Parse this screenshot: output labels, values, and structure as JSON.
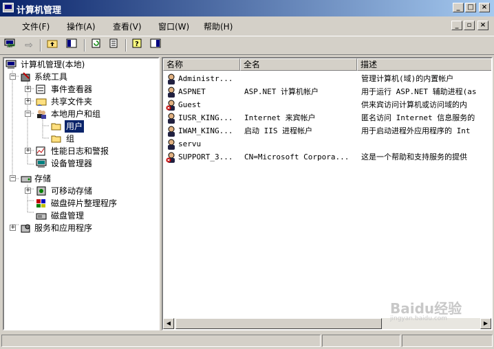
{
  "window": {
    "title": "计算机管理"
  },
  "menu": {
    "file": "文件(F)",
    "action": "操作(A)",
    "view": "查看(V)",
    "window": "窗口(W)",
    "help": "帮助(H)"
  },
  "tree": {
    "root": "计算机管理(本地)",
    "system_tools": "系统工具",
    "event_viewer": "事件查看器",
    "shared_folders": "共享文件夹",
    "local_users_groups": "本地用户和组",
    "users": "用户",
    "groups": "组",
    "perf_logs": "性能日志和警报",
    "device_manager": "设备管理器",
    "storage": "存储",
    "removable_storage": "可移动存储",
    "defrag": "磁盘碎片整理程序",
    "disk_mgmt": "磁盘管理",
    "services_apps": "服务和应用程序"
  },
  "list": {
    "columns": {
      "name": "名称",
      "fullname": "全名",
      "description": "描述"
    },
    "rows": [
      {
        "name": "Administr...",
        "fullname": "",
        "description": "管理计算机(域)的内置帐户",
        "icon": "user-icon"
      },
      {
        "name": "ASPNET",
        "fullname": "ASP.NET 计算机帐户",
        "description": "用于运行 ASP.NET 辅助进程(as",
        "icon": "user-icon"
      },
      {
        "name": "Guest",
        "fullname": "",
        "description": "供来宾访问计算机或访问域的内",
        "icon": "user-disabled-icon"
      },
      {
        "name": "IUSR_KING...",
        "fullname": "Internet 来宾帐户",
        "description": "匿名访问 Internet 信息服务的",
        "icon": "user-icon"
      },
      {
        "name": "IWAM_KING...",
        "fullname": "启动 IIS 进程帐户",
        "description": "用于启动进程外应用程序的 Int",
        "icon": "user-icon"
      },
      {
        "name": "servu",
        "fullname": "",
        "description": "",
        "icon": "user-icon"
      },
      {
        "name": "SUPPORT_3...",
        "fullname": "CN=Microsoft Corpora...",
        "description": "这是一个帮助和支持服务的提供",
        "icon": "user-disabled-icon"
      }
    ]
  },
  "watermark": {
    "brand": "Baidu经验",
    "url": "jingyan.baidu.com"
  },
  "colors": {
    "title_start": "#0a246a",
    "title_end": "#a6caf0",
    "selection": "#0a246a",
    "disabled_badge": "#c00000"
  }
}
